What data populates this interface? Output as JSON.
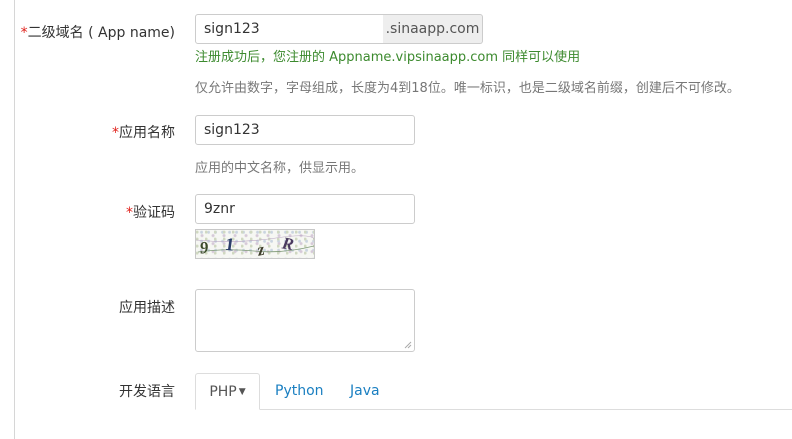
{
  "form": {
    "subdomain": {
      "required_mark": "*",
      "label": "二级域名 ( App name)",
      "value": "sign123",
      "suffix": ".sinaapp.com",
      "success_message": "注册成功后，您注册的 Appname.vipsinaapp.com 同样可以使用",
      "help": "仅允许由数字，字母组成，长度为4到18位。唯一标识，也是二级域名前缀，创建后不可修改。"
    },
    "app_name": {
      "required_mark": "*",
      "label": "应用名称",
      "value": "sign123",
      "help": "应用的中文名称，供显示用。"
    },
    "captcha": {
      "required_mark": "*",
      "label": "验证码",
      "value": "9znr",
      "image_chars": [
        "9",
        "1",
        "z",
        "R"
      ]
    },
    "description": {
      "label": "应用描述",
      "value": ""
    },
    "language": {
      "label": "开发语言",
      "tabs": [
        {
          "label": "PHP",
          "active": true,
          "has_caret": true
        },
        {
          "label": "Python",
          "active": false
        },
        {
          "label": "Java",
          "active": false
        }
      ]
    }
  },
  "colors": {
    "required": "#e0201a",
    "success": "#3c8a2e",
    "link": "#1a7fc1",
    "help": "#777777",
    "border": "#cccccc",
    "addon_bg": "#eeeeee"
  },
  "icons": {
    "caret": "caret-down-icon",
    "resize": "resize-grip-icon"
  }
}
